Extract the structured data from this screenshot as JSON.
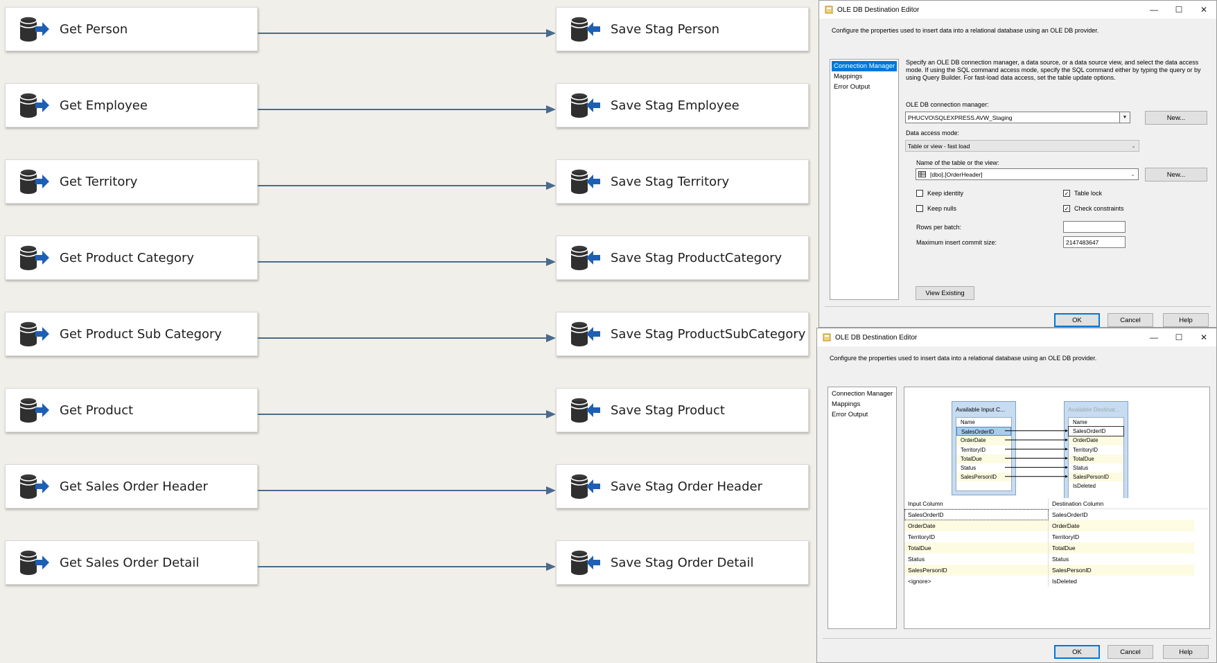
{
  "flows": [
    {
      "source": "Get Person",
      "destination": "Save Stag Person"
    },
    {
      "source": "Get Employee",
      "destination": "Save Stag Employee"
    },
    {
      "source": "Get Territory",
      "destination": "Save Stag Territory"
    },
    {
      "source": "Get Product Category",
      "destination": "Save Stag ProductCategory"
    },
    {
      "source": "Get Product Sub Category",
      "destination": "Save Stag ProductSubCategory"
    },
    {
      "source": "Get Product",
      "destination": "Save Stag Product"
    },
    {
      "source": "Get Sales Order Header",
      "destination": "Save Stag Order Header"
    },
    {
      "source": "Get Sales Order Detail",
      "destination": "Save Stag Order Detail"
    }
  ],
  "icons": {
    "source": "db-source-icon",
    "destination": "db-destination-icon"
  },
  "colors": {
    "arrow_blue": "#1e5fb4",
    "connector": "#4a6a8c",
    "selection": "#0078d7"
  },
  "editor1": {
    "title": "OLE DB Destination Editor",
    "description": "Configure the properties used to insert data into a relational database using an OLE DB provider.",
    "nav": [
      "Connection Manager",
      "Mappings",
      "Error Output"
    ],
    "info": "Specify an OLE DB connection manager, a data source, or a data source view, and select the data access mode. If using the SQL command access mode, specify the SQL command either by typing the query or by using Query Builder. For fast-load data access, set the table update options.",
    "conn_label": "OLE DB connection manager:",
    "conn_value": "PHUCVO\\SQLEXPRESS.AVW_Staging",
    "new_label": "New...",
    "access_label": "Data access mode:",
    "access_value": "Table or view - fast load",
    "table_label": "Name of the table or the view:",
    "table_value": "[dbo].[OrderHeader]",
    "keep_identity": "Keep identity",
    "keep_nulls": "Keep nulls",
    "table_lock": "Table lock",
    "check_constraints": "Check constraints",
    "rows_per_batch_label": "Rows per batch:",
    "rows_per_batch_value": "",
    "max_commit_label": "Maximum insert commit size:",
    "max_commit_value": "2147483647",
    "view_existing": "View Existing",
    "ok": "OK",
    "cancel": "Cancel",
    "help": "Help"
  },
  "editor2": {
    "title": "OLE DB Destination Editor",
    "description": "Configure the properties used to insert data into a relational database using an OLE DB provider.",
    "nav": [
      "Connection Manager",
      "Mappings",
      "Error Output"
    ],
    "input_box_title": "Available Input C...",
    "dest_box_title": "Available Destinat...",
    "list_header": "Name",
    "input_columns": [
      "SalesOrderID",
      "OrderDate",
      "TerritoryID",
      "TotalDue",
      "Status",
      "SalesPersonID"
    ],
    "dest_columns": [
      "SalesOrderID",
      "OrderDate",
      "TerritoryID",
      "TotalDue",
      "Status",
      "SalesPersonID",
      "IsDeleted"
    ],
    "grid_headers": [
      "Input Column",
      "Destination Column"
    ],
    "grid_rows": [
      [
        "SalesOrderID",
        "SalesOrderID"
      ],
      [
        "OrderDate",
        "OrderDate"
      ],
      [
        "TerritoryID",
        "TerritoryID"
      ],
      [
        "TotalDue",
        "TotalDue"
      ],
      [
        "Status",
        "Status"
      ],
      [
        "SalesPersonID",
        "SalesPersonID"
      ],
      [
        "<ignore>",
        "IsDeleted"
      ]
    ],
    "ok": "OK",
    "cancel": "Cancel",
    "help": "Help"
  }
}
